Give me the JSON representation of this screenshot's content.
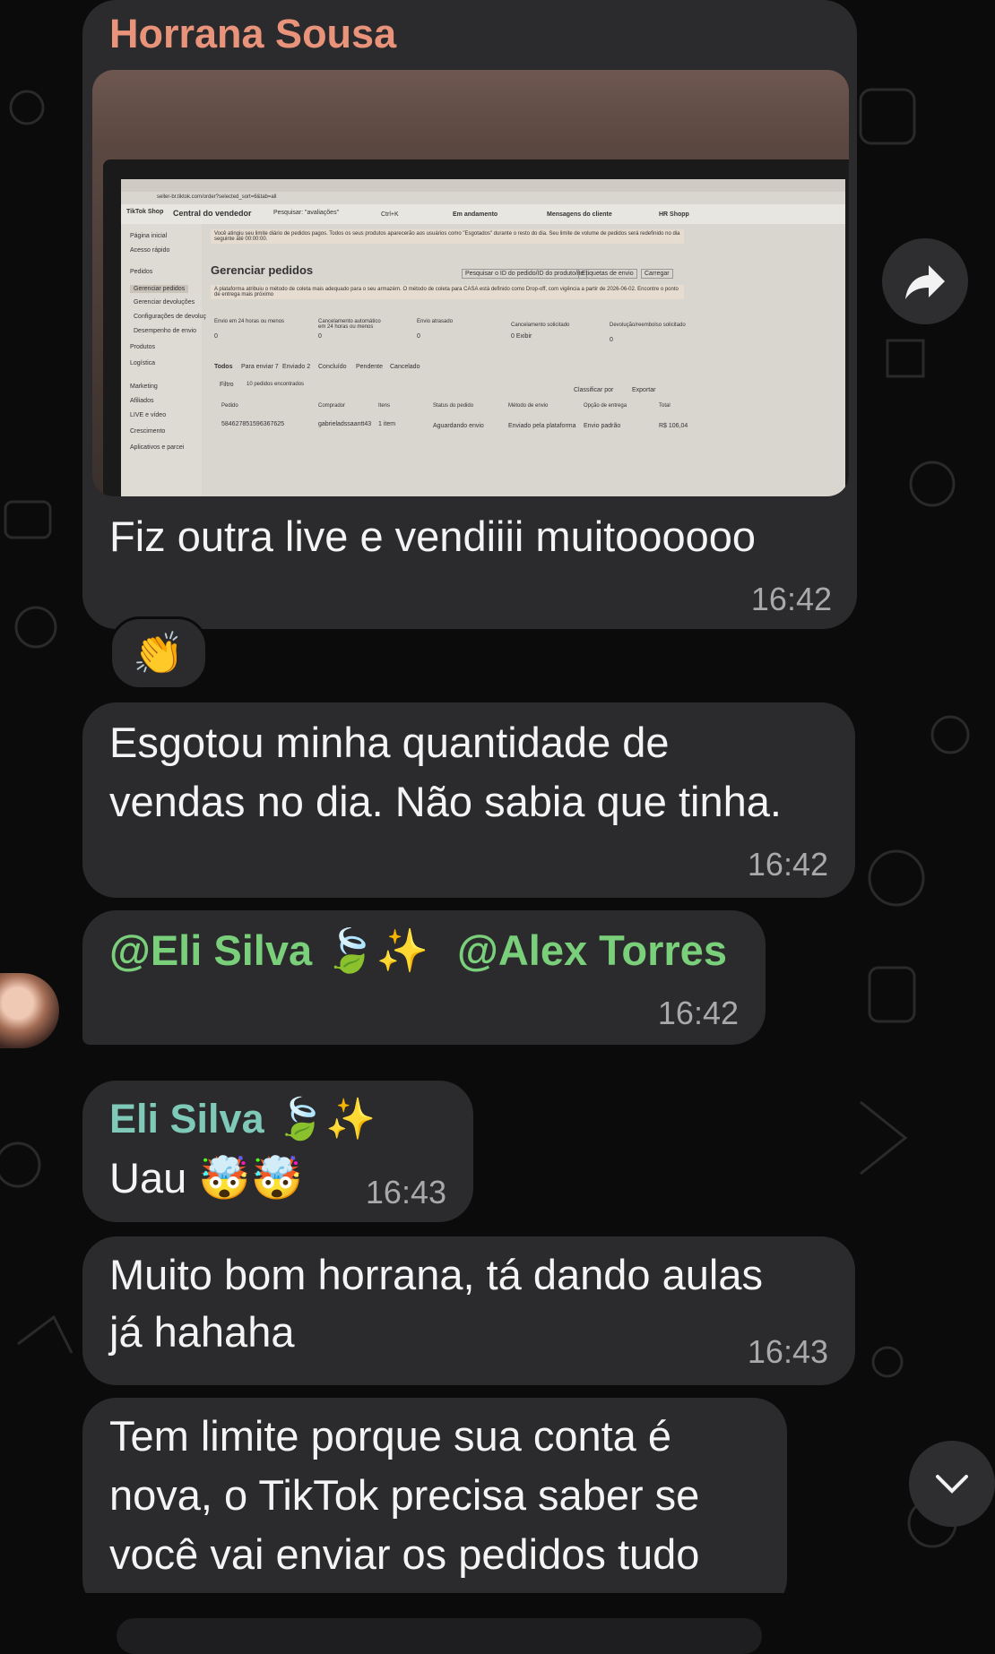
{
  "messages": {
    "m1": {
      "sender": "Horrana Sousa",
      "sender_color": "#e9937a",
      "text": "Fiz outra live e vendiiii muitoooooo",
      "time": "16:42",
      "reaction": "👏",
      "photo": {
        "nav_home": "Página inicial",
        "nav_quick": "Acesso rápido",
        "nav_orders": "Pedidos",
        "nav_manage": "Gerenciar pedidos",
        "nav_returns": "Gerenciar devoluções",
        "nav_settings": "Configurações de devoluç",
        "nav_perf": "Desempenho de envio",
        "nav_products": "Produtos",
        "nav_logistics": "Logística",
        "nav_marketing": "Marketing",
        "nav_affiliates": "Afiliados",
        "nav_live": "LIVE e vídeo",
        "nav_growth": "Crescimento",
        "nav_apps": "Aplicativos e parcei",
        "brand": "TikTok Shop",
        "central": "Central do vendedor",
        "search": "Pesquisar: \"avaliações\"",
        "shortcut": "Ctrl+K",
        "status": "Em andamento",
        "messages": "Mensagens do cliente",
        "shop": "HR Shopp",
        "url": "seller-br.tiktok.com/order?selected_sort=6&tab=all",
        "alert1": "Você atingiu seu limite diário de pedidos pagos. Todos os seus produtos aparecerão aos usuários como \"Esgotados\" durante o resto do dia. Seu limite de volume de pedidos será redefinido no dia seguinte até 00:00:00.",
        "title": "Gerenciar pedidos",
        "search_orders": "Pesquisar o ID do pedido/ID do produto/ite",
        "labels": "Etiquetas de envio",
        "load": "Carregar",
        "alert2": "A plataforma atribuiu o método de coleta mais adequado para o seu armazém. O método de coleta para CASA está definido como Drop-off, com vigência a partir de 2026-06-02. Encontre o ponto de entrega mais próximo",
        "stats": [
          {
            "label": "Envio em 24 horas ou menos",
            "value": "0"
          },
          {
            "label": "Cancelamento automático em 24 horas ou menos",
            "value": "0"
          },
          {
            "label": "Envio atrasado",
            "value": "0"
          },
          {
            "label": "Cancelamento solicitado",
            "value": "0 Exibir"
          },
          {
            "label": "Devolução/reembolso solicitado",
            "value": "0"
          }
        ],
        "tabs": [
          "Todos",
          "Para enviar 7",
          "Enviado 2",
          "Concluído",
          "Pendente",
          "Cancelado"
        ],
        "filter": "Filtro",
        "found": "10 pedidos encontrados",
        "sort": "Classificar por",
        "export": "Exportar",
        "cols": [
          "Pedido",
          "Comprador",
          "Itens",
          "Status do pedido",
          "Método de envio",
          "Opção de entrega",
          "Total"
        ],
        "row": [
          "584627851596367625",
          "gabrieladssaantt43",
          "1 item",
          "Aguardando envio",
          "Enviado pela plataforma",
          "Envio padrão",
          "R$ 106,04"
        ]
      }
    },
    "m2": {
      "text_line1": "Esgotou minha quantidade de",
      "text_line2": "vendas no dia. Não sabia que tinha.",
      "time": "16:42"
    },
    "m3": {
      "mention1": "@Eli Silva 🍃✨",
      "mention2": "@Alex Torres",
      "time": "16:42"
    },
    "m4": {
      "sender": "Eli Silva 🍃✨",
      "sender_color": "#7fc9b9",
      "text": "Uau 🤯🤯",
      "time": "16:43"
    },
    "m5": {
      "text_line1": "Muito bom horrana, tá dando aulas",
      "text_line2": "já hahaha",
      "time": "16:43"
    },
    "m6": {
      "text_line1": "Tem limite porque sua conta é",
      "text_line2": "nova, o TikTok precisa saber se",
      "text_line3": "você vai enviar os pedidos tudo"
    }
  },
  "icons": {
    "forward": "forward-arrow-icon",
    "scroll_down": "chevron-down-icon",
    "avatar": "avatar"
  }
}
